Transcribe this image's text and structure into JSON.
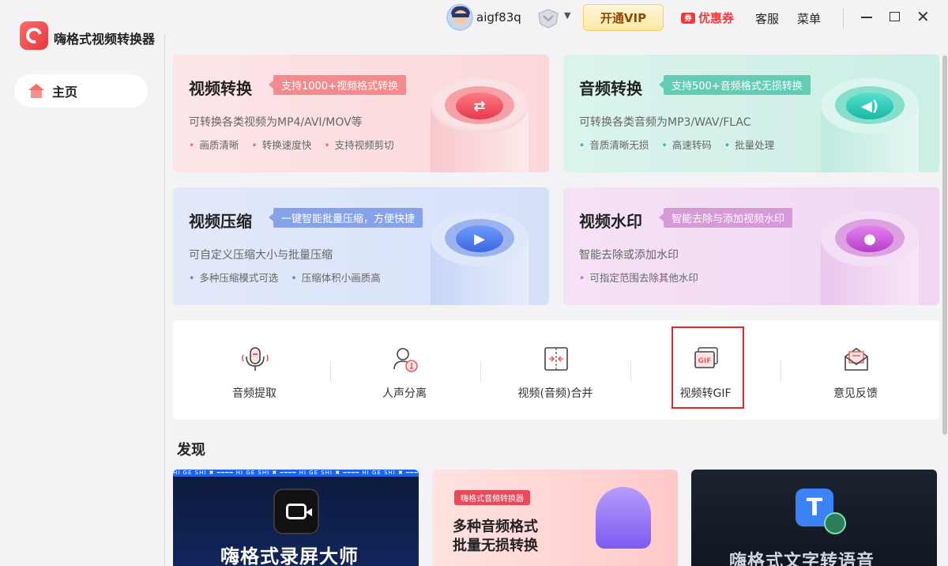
{
  "app": {
    "title": "嗨格式视频转换器"
  },
  "topbar": {
    "username": "aigf83q",
    "vip_label": "开通VIP",
    "coupon_label": "优惠券",
    "coupon_tag": "券",
    "service_label": "客服",
    "menu_label": "菜单"
  },
  "sidebar": {
    "items": [
      {
        "label": "主页",
        "icon": "home-icon",
        "active": true
      }
    ]
  },
  "cards": [
    {
      "title": "视频转换",
      "tagline": "支持1000+视频格式转换",
      "desc": "可转换各类视频为MP4/AVI/MOV等",
      "points": [
        "画质清晰",
        "转换速度快",
        "支持视频剪切"
      ],
      "icon": "convert-arrows-icon",
      "color": "#e6394a"
    },
    {
      "title": "音频转换",
      "tagline": "支持500+音频格式无损转换",
      "desc": "可转换各类音频为MP3/WAV/FLAC",
      "points": [
        "音质清晰无损",
        "高速转码",
        "批量处理"
      ],
      "icon": "speaker-icon",
      "color": "#17b8a6"
    },
    {
      "title": "视频压缩",
      "tagline": "一键智能批量压缩，方便快捷",
      "desc": "可自定义压缩大小与批量压缩",
      "points": [
        "多种压缩模式可选",
        "压缩体积小画质高"
      ],
      "icon": "play-compress-icon",
      "color": "#3d66e0"
    },
    {
      "title": "视频水印",
      "tagline": "智能去除与添加视频水印",
      "desc": "智能去除或添加水印",
      "points": [
        "可指定范围去除其他水印"
      ],
      "icon": "drop-icon",
      "color": "#b43fc8"
    }
  ],
  "tools": [
    {
      "label": "音频提取",
      "icon": "microphone-icon"
    },
    {
      "label": "人声分离",
      "icon": "voice-separate-icon"
    },
    {
      "label": "视频(音频)合并",
      "icon": "merge-icon"
    },
    {
      "label": "视频转GIF",
      "icon": "gif-icon",
      "highlighted": true
    },
    {
      "label": "意见反馈",
      "icon": "feedback-mail-icon"
    }
  ],
  "discover": {
    "title": "发现",
    "banners": [
      {
        "strip": "HI GE SHI  ✖ ━━━━  HI GE SHI  ✖ ━━━━  HI GE SHI  ✖ ━━━━  HI GE SHI  ✖ ━━━━  HI GE SHI  ✖",
        "title": "嗨格式录屏大师"
      },
      {
        "chip": "嗨格式音频转换器",
        "line1": "多种音频格式",
        "line2": "批量无损转换"
      },
      {
        "icon_letter": "T",
        "title": "嗨格式文字转语音"
      }
    ]
  }
}
